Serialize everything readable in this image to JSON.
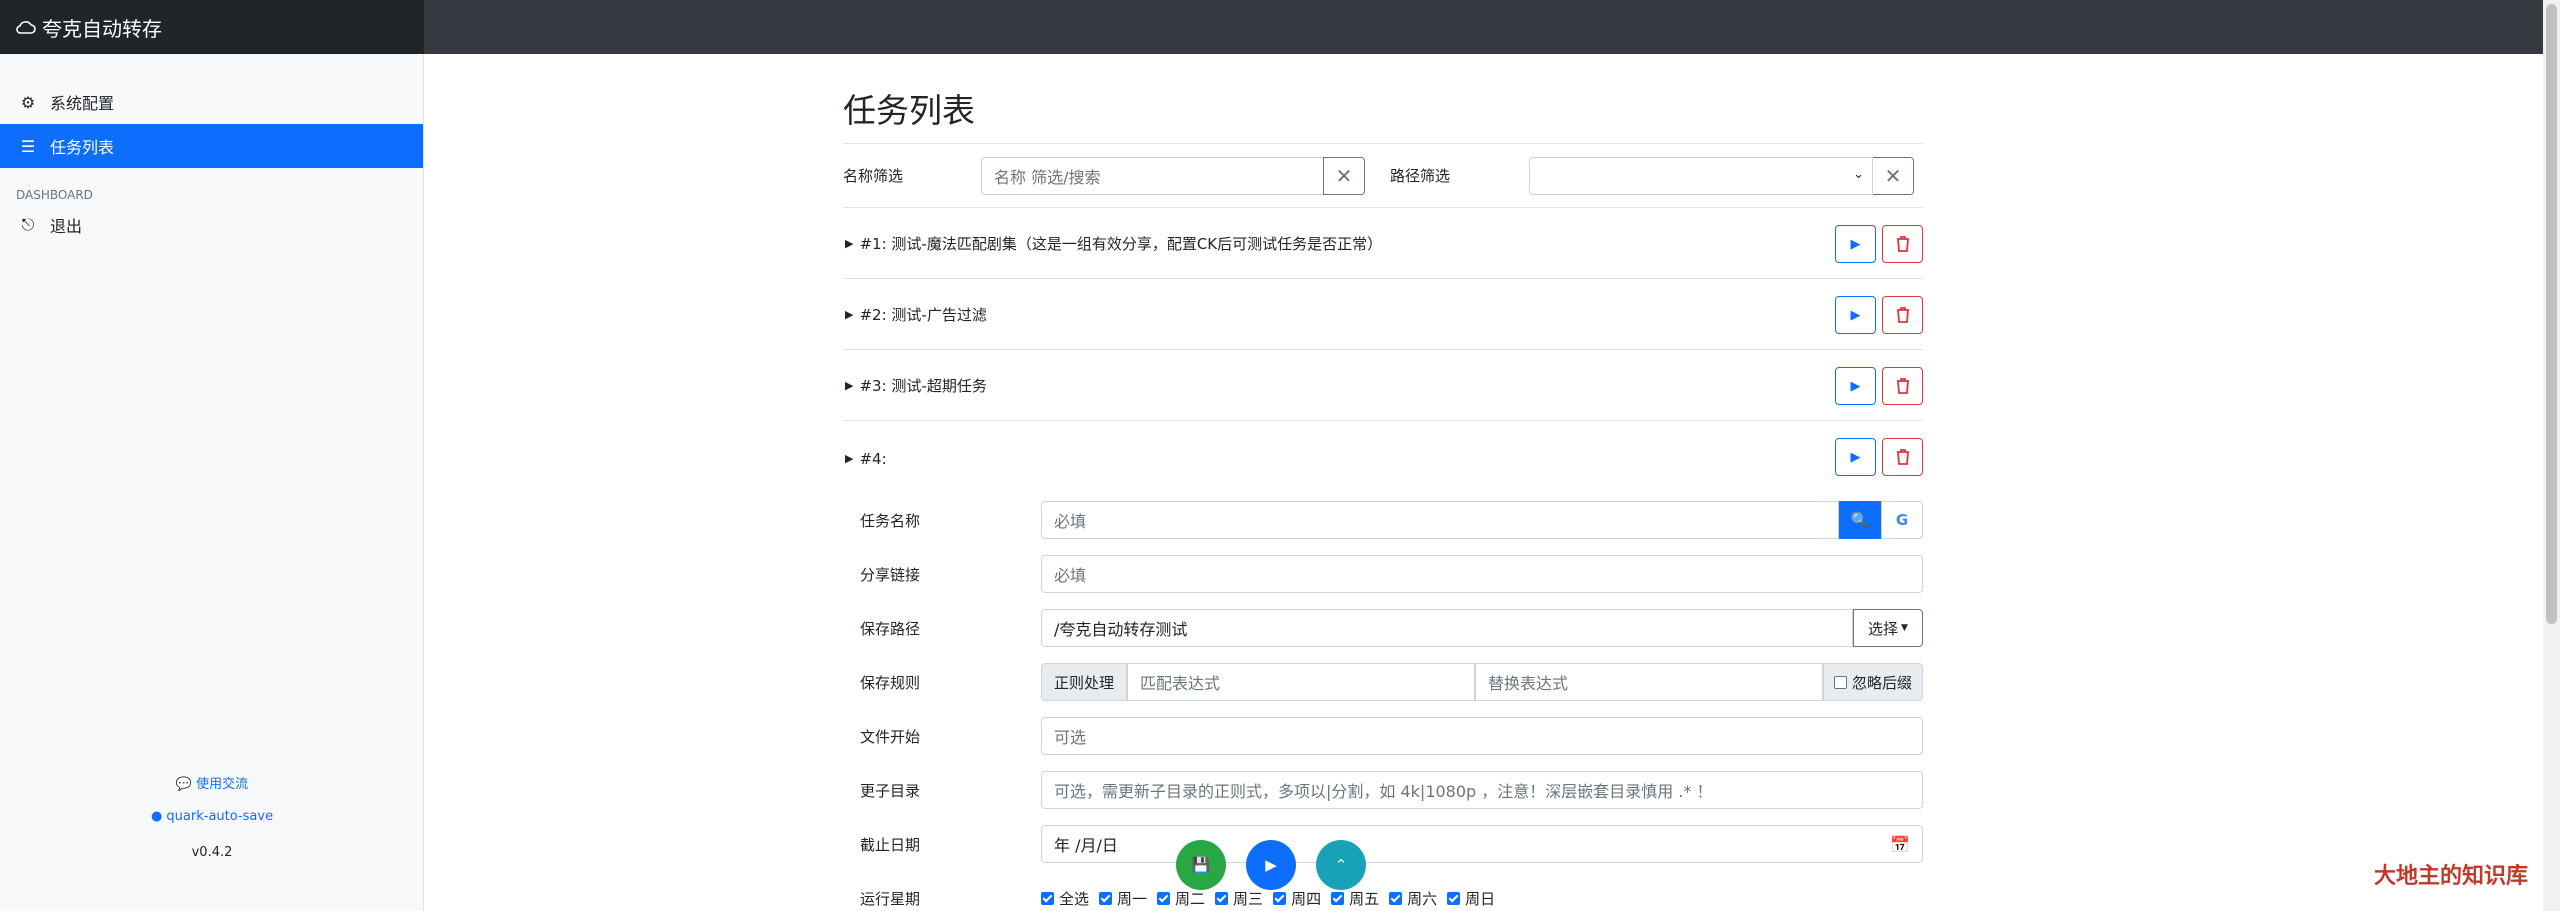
{
  "app": {
    "title": "夸克自动转存"
  },
  "sidebar": {
    "items": [
      {
        "label": "系统配置",
        "icon": "gear-icon"
      },
      {
        "label": "任务列表",
        "icon": "list-icon",
        "active": true
      }
    ],
    "heading": "DASHBOARD",
    "logout_label": "退出",
    "footer": {
      "community": "使用交流",
      "repo": "quark-auto-save",
      "version": "v0.4.2"
    }
  },
  "main": {
    "title": "任务列表",
    "filters": {
      "name_label": "名称筛选",
      "name_placeholder": "名称 筛选/搜索",
      "path_label": "路径筛选",
      "path_value": ""
    },
    "tasks": [
      {
        "title": "#1: 测试-魔法匹配剧集（这是一组有效分享，配置CK后可测试任务是否正常）"
      },
      {
        "title": "#2: 测试-广告过滤"
      },
      {
        "title": "#3: 测试-超期任务"
      },
      {
        "title": "#4:"
      }
    ],
    "form": {
      "name_label": "任务名称",
      "name_placeholder": "必填",
      "share_label": "分享链接",
      "share_placeholder": "必填",
      "savepath_label": "保存路径",
      "savepath_value": "/夸克自动转存测试",
      "savepath_select": "选择",
      "rule_label": "保存规则",
      "rule_prefix": "正则处理",
      "rule_pattern_placeholder": "匹配表达式",
      "rule_replace_placeholder": "替换表达式",
      "rule_ignore_ext": "忽略后缀",
      "startfile_label": "文件开始",
      "startfile_placeholder": "可选",
      "subdir_label": "更子目录",
      "subdir_placeholder": "可选，需更新子目录的正则式，多项以|分割，如 4k|1080p ，注意！深层嵌套目录慎用 .* ！",
      "enddate_label": "截止日期",
      "enddate_placeholder": "年 /月/日",
      "weekday_label": "运行星期",
      "weekdays": [
        "全选",
        "周一",
        "周二",
        "周三",
        "周四",
        "周五",
        "周六",
        "周日"
      ]
    }
  },
  "fabs": {
    "save_color": "#28a745",
    "run_color": "#0d6efd",
    "top_color": "#17a2b8"
  },
  "watermark": "大地主的知识库"
}
